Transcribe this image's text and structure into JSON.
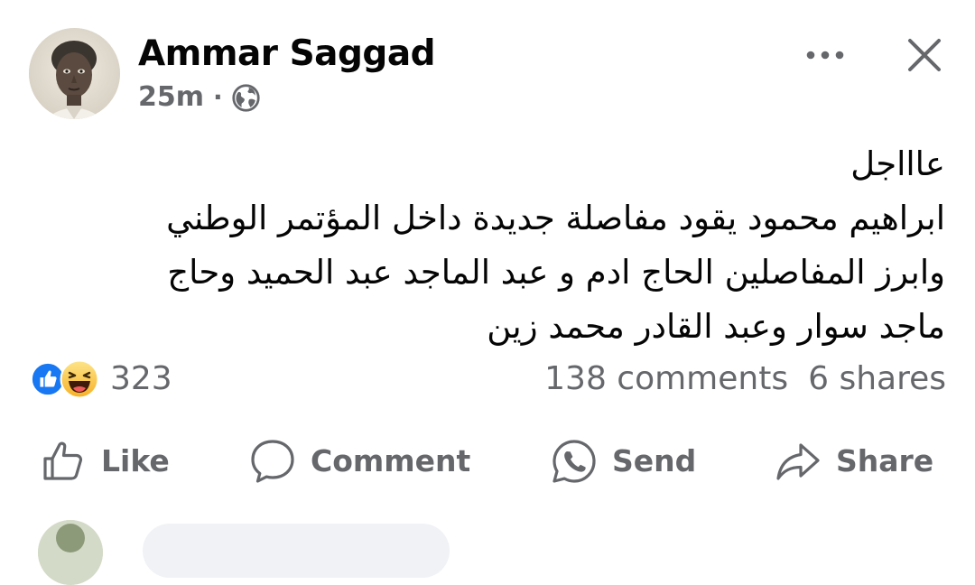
{
  "post": {
    "author": "Ammar Saggad",
    "time": "25m",
    "separator": "·",
    "audience_icon": "globe-icon",
    "text_lines": [
      "عاااجل",
      "ابراهيم محمود يقود مفاصلة جديدة داخل المؤتمر الوطني",
      "وابرز المفاصلين الحاج ادم و عبد الماجد عبد الحميد وحاج",
      "ماجد سوار وعبد القادر محمد زين"
    ]
  },
  "header_actions": {
    "more_icon": "more-horizontal-icon",
    "close_icon": "close-icon"
  },
  "engagement": {
    "reaction_icons": [
      "like-reaction-icon",
      "haha-reaction-icon"
    ],
    "reaction_count": "323",
    "comments": "138 comments",
    "shares": "6 shares"
  },
  "actions": {
    "like": "Like",
    "comment": "Comment",
    "send": "Send",
    "share": "Share"
  },
  "colors": {
    "text_primary": "#050505",
    "text_secondary": "#65676b",
    "like_blue": "#1877f2",
    "haha_yellow": "#f7b125"
  }
}
